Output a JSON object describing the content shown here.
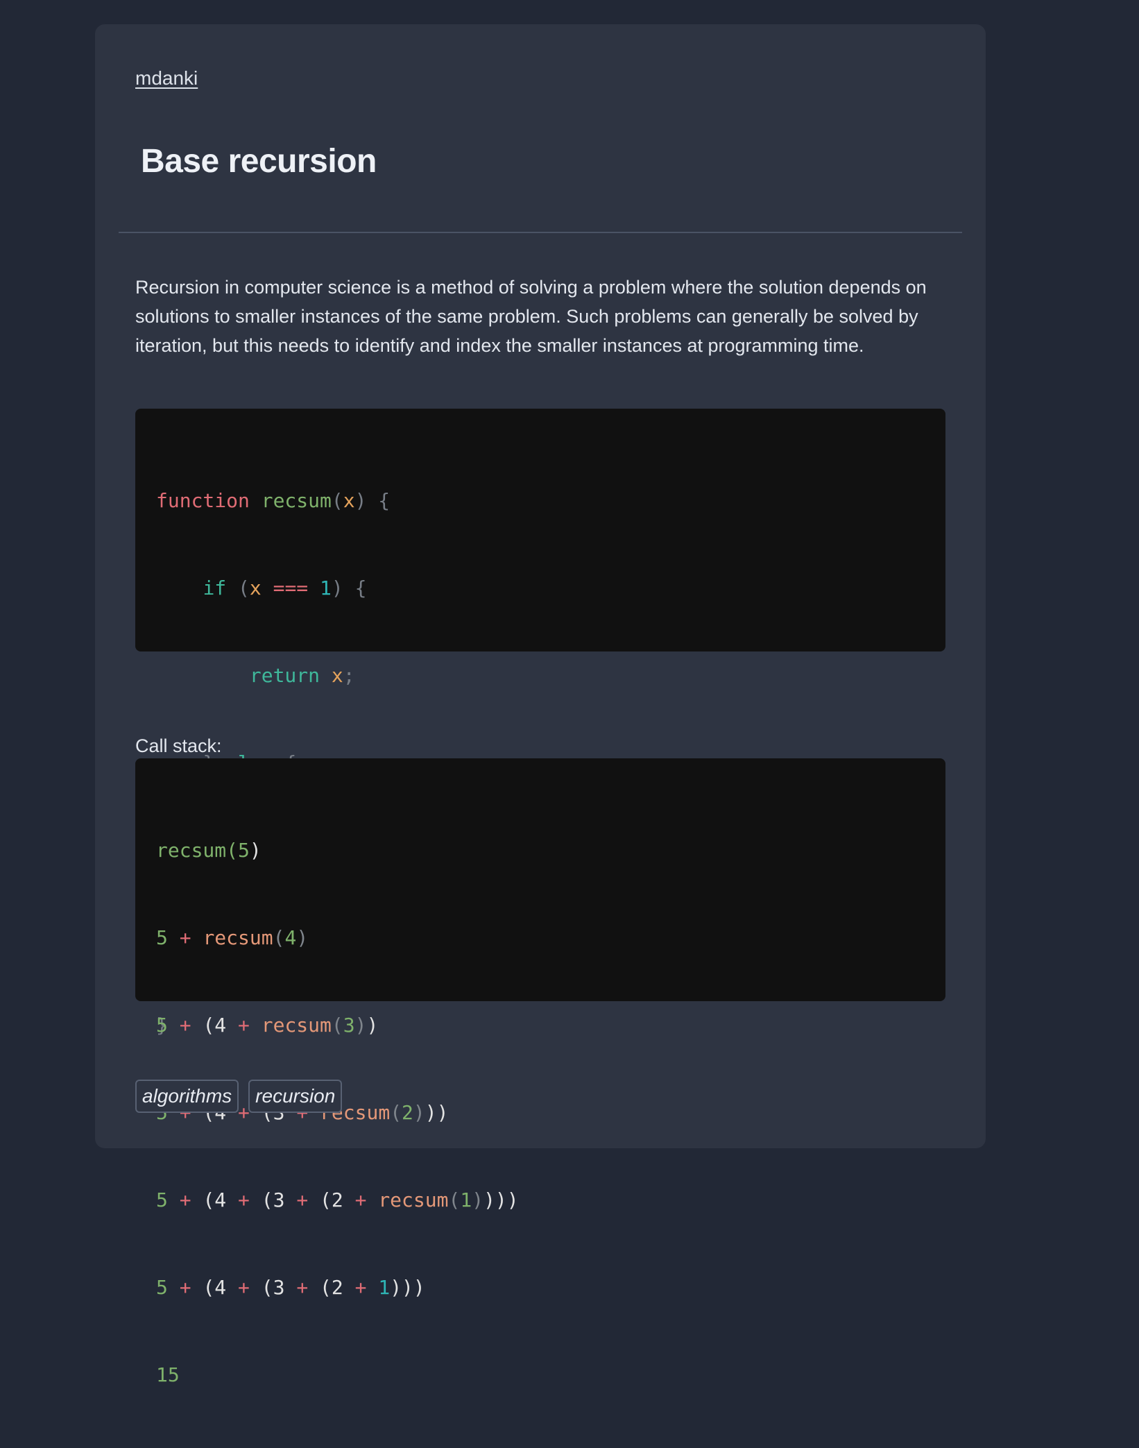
{
  "header": {
    "site_link": "mdanki"
  },
  "card": {
    "title": "Base recursion",
    "paragraph": "Recursion in computer science is a method of solving a problem where the solution depends on solutions to smaller instances of the same problem. Such problems can generally be solved by iteration, but this needs to identify and index the smaller instances at programming time.",
    "call_stack_label": "Call stack:"
  },
  "code_block": {
    "tokens": {
      "function": "function",
      "name": "recsum",
      "param": "x",
      "if": "if",
      "strict_eq": "===",
      "one": "1",
      "return": "return",
      "else": "else",
      "plus": "+",
      "minus": "-"
    }
  },
  "call_stack": {
    "fn": "recsum",
    "numbers": [
      "5",
      "4",
      "3",
      "2",
      "1"
    ],
    "result": "15"
  },
  "tags": [
    "algorithms",
    "recursion"
  ],
  "colors": {
    "background": "#222836",
    "card": "#2e3442",
    "code_bg": "#111111",
    "keyword": "#e06c75",
    "function_name": "#7fb26b",
    "control": "#3fb89b",
    "variable": "#e5a35c",
    "number": "#2fb6b6"
  }
}
